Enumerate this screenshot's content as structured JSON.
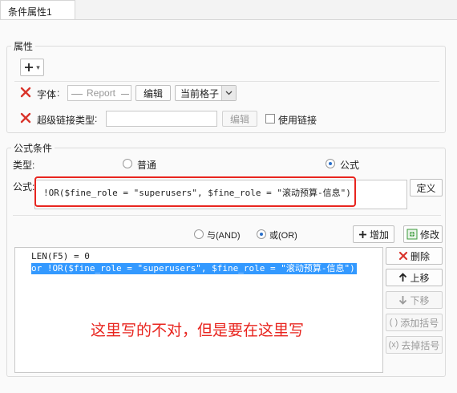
{
  "tab": {
    "title": "条件属性1"
  },
  "attributes": {
    "legend": "属性",
    "add_dropdown": {
      "icon": "plus-icon",
      "caret": "▾"
    },
    "font_row": {
      "label": "字体",
      "preview_text": "Report",
      "edit_button": "编辑",
      "scope_select": "当前格子"
    },
    "hyperlink_row": {
      "label": "超级链接类型",
      "value": "",
      "edit_button": "编辑",
      "use_link_label": "使用链接"
    }
  },
  "formula_condition": {
    "legend": "公式条件",
    "type_label": "类型:",
    "type_options": [
      {
        "label": "普通",
        "selected": false
      },
      {
        "label": "公式",
        "selected": true
      }
    ],
    "formula_label": "公式:",
    "formula_value": "!OR($fine_role = \"superusers\", $fine_role = \"滚动预算-信息\")",
    "define_button": "定义",
    "logic_options": [
      {
        "label": "与(AND)",
        "selected": false
      },
      {
        "label": "或(OR)",
        "selected": true
      }
    ],
    "add_button": "增加",
    "modify_button": "修改",
    "conditions": [
      {
        "text": "LEN(F5) = 0",
        "selected": false
      },
      {
        "text": "or  !OR($fine_role = \"superusers\", $fine_role = \"滚动预算-信息\")",
        "selected": true
      }
    ],
    "annotation": "这里写的不对，但是要在这里写",
    "side_buttons": {
      "delete": "删除",
      "move_up": "上移",
      "move_down": "下移",
      "add_bracket": "添加括号",
      "remove_bracket": "去掉括号"
    }
  },
  "colors": {
    "accent": "#2a6fc9",
    "highlight": "#e8251f",
    "selection": "#3399ff",
    "add_green": "#3a9a3a"
  }
}
